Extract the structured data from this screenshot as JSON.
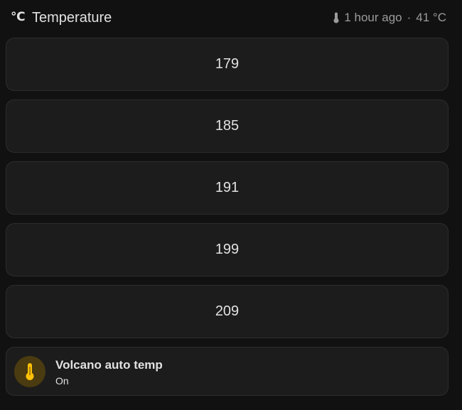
{
  "header": {
    "unit_symbol": "℃",
    "title": "Temperature",
    "status_icon": "thermometer-icon",
    "last_updated": "1 hour ago",
    "separator": "·",
    "current_value": "41 °C"
  },
  "presets": [
    {
      "label": "179"
    },
    {
      "label": "185"
    },
    {
      "label": "191"
    },
    {
      "label": "199"
    },
    {
      "label": "209"
    }
  ],
  "entity_tile": {
    "icon": "thermometer-icon",
    "name": "Volcano auto temp",
    "state": "On",
    "accent_color": "#ffc107"
  },
  "colors": {
    "background": "#111111",
    "card": "#1c1c1c",
    "text": "#e1e1e1",
    "secondary_text": "#9b9b9b",
    "accent": "#ffc107"
  }
}
